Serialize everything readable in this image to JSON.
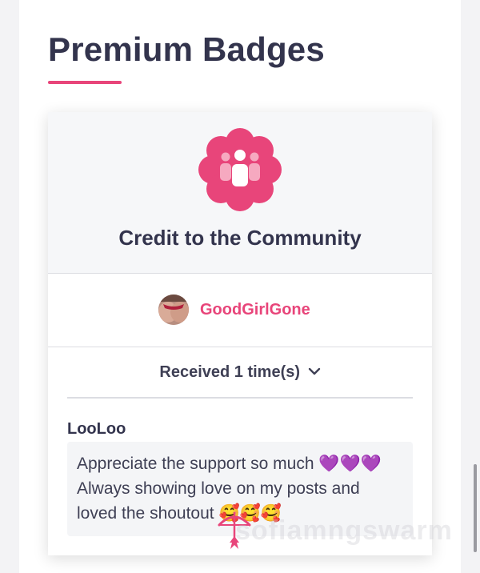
{
  "page": {
    "title": "Premium Badges"
  },
  "badge": {
    "icon": "community-people-icon",
    "name": "Credit to the Community",
    "owner": {
      "avatar": "user-avatar",
      "username": "GoodGirlGone"
    },
    "received_label": "Received 1 time(s)",
    "received_icon": "chevron-down-icon",
    "awards": [
      {
        "giver": "LooLoo",
        "message": "Appreciate the support so much 💜💜💜 Always showing love on my posts and loved the shoutout 🥰🥰🥰"
      }
    ]
  },
  "watermark": {
    "logo": "bow-arrow-logo",
    "text": "sofiamngswarm"
  },
  "colors": {
    "accent": "#e8457a",
    "heading": "#33344d",
    "card_header_bg": "#f6f7f9",
    "message_bg": "#f4f5f7"
  }
}
